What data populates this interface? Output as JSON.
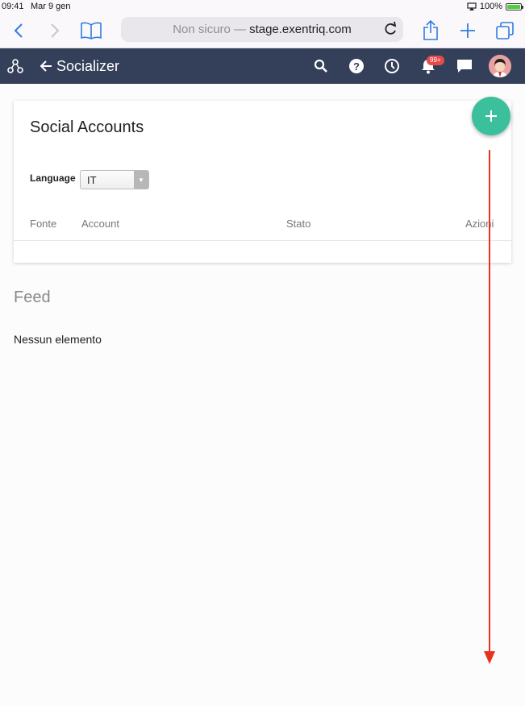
{
  "status_bar": {
    "time": "09:41",
    "date": "Mar 9 gen",
    "battery": "100%"
  },
  "browser": {
    "url_prefix": "Non sicuro —",
    "url_host": "stage.exentriq.com",
    "icons": [
      "chevron-left-icon",
      "chevron-right-icon",
      "bookmarks-icon",
      "reload-icon",
      "share-icon",
      "new-tab-icon",
      "tabs-icon"
    ]
  },
  "header": {
    "title": "Socializer",
    "notifications_badge": "99+",
    "icons": [
      "network-icon",
      "back-arrow-icon",
      "search-icon",
      "help-icon",
      "history-icon",
      "bell-icon",
      "chat-icon",
      "avatar"
    ]
  },
  "social_accounts": {
    "title": "Social Accounts",
    "language_label": "Language",
    "language_value": "IT",
    "columns": [
      "Fonte",
      "Account",
      "Stato",
      "Azioni"
    ]
  },
  "feed": {
    "title": "Feed",
    "empty_text": "Nessun elemento"
  },
  "colors": {
    "header_bg": "#34405a",
    "fab": "#3bbf9c",
    "link": "#2f7de1",
    "badge": "#e84a4a",
    "annotation_arrow": "#e8321e"
  }
}
